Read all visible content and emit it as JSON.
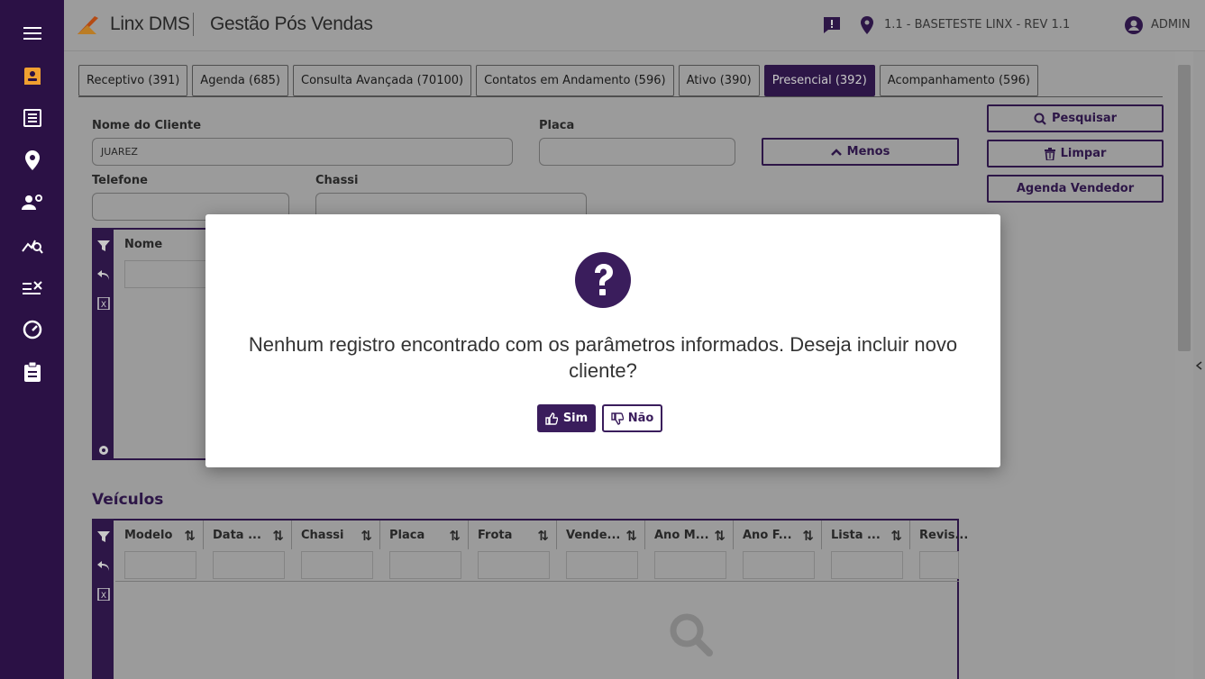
{
  "header": {
    "brand": "Linx DMS",
    "module": "Gestão Pós Vendas",
    "branch": "1.1 - BASETESTE LINX - REV 1.1",
    "user": "ADMIN"
  },
  "sidebar": {
    "items": [
      {
        "icon": "menu-icon"
      },
      {
        "icon": "contact-card-icon",
        "active": true
      },
      {
        "icon": "list-icon"
      },
      {
        "icon": "location-pin-icon"
      },
      {
        "icon": "user-settings-icon"
      },
      {
        "icon": "chart-search-icon"
      },
      {
        "icon": "checklist-icon"
      },
      {
        "icon": "speedometer-icon"
      },
      {
        "icon": "clipboard-icon"
      }
    ]
  },
  "tabs": [
    {
      "label": "Receptivo (391)"
    },
    {
      "label": "Agenda (685)"
    },
    {
      "label": "Consulta Avançada (70100)"
    },
    {
      "label": "Contatos em Andamento (596)"
    },
    {
      "label": "Ativo (390)"
    },
    {
      "label": "Presencial (392)",
      "active": true
    },
    {
      "label": "Acompanhamento (596)"
    }
  ],
  "form": {
    "nome_label": "Nome do Cliente",
    "nome_value": "JUAREZ",
    "placa_label": "Placa",
    "placa_value": "",
    "telefone_label": "Telefone",
    "telefone_value": "",
    "chassi_label": "Chassi",
    "chassi_value": "",
    "menos_button": "Menos",
    "pesquisar_button": "Pesquisar",
    "limpar_button": "Limpar",
    "agenda_button": "Agenda Vendedor"
  },
  "clientes_grid": {
    "columns": [
      "Nome"
    ]
  },
  "veiculos": {
    "title": "Veículos",
    "columns": [
      "Modelo",
      "Data ...",
      "Chassi",
      "Placa",
      "Frota",
      "Vende...",
      "Ano M...",
      "Ano F...",
      "Lista ...",
      "Revis..."
    ]
  },
  "dialog": {
    "message": "Nenhum registro encontrado com os parâmetros informados. Deseja incluir novo cliente?",
    "yes_label": "Sim",
    "no_label": "Não"
  },
  "colors": {
    "brand_purple": "#3a1d5c",
    "sidebar_bg": "#2b1145",
    "accent_orange": "#f0a030"
  }
}
